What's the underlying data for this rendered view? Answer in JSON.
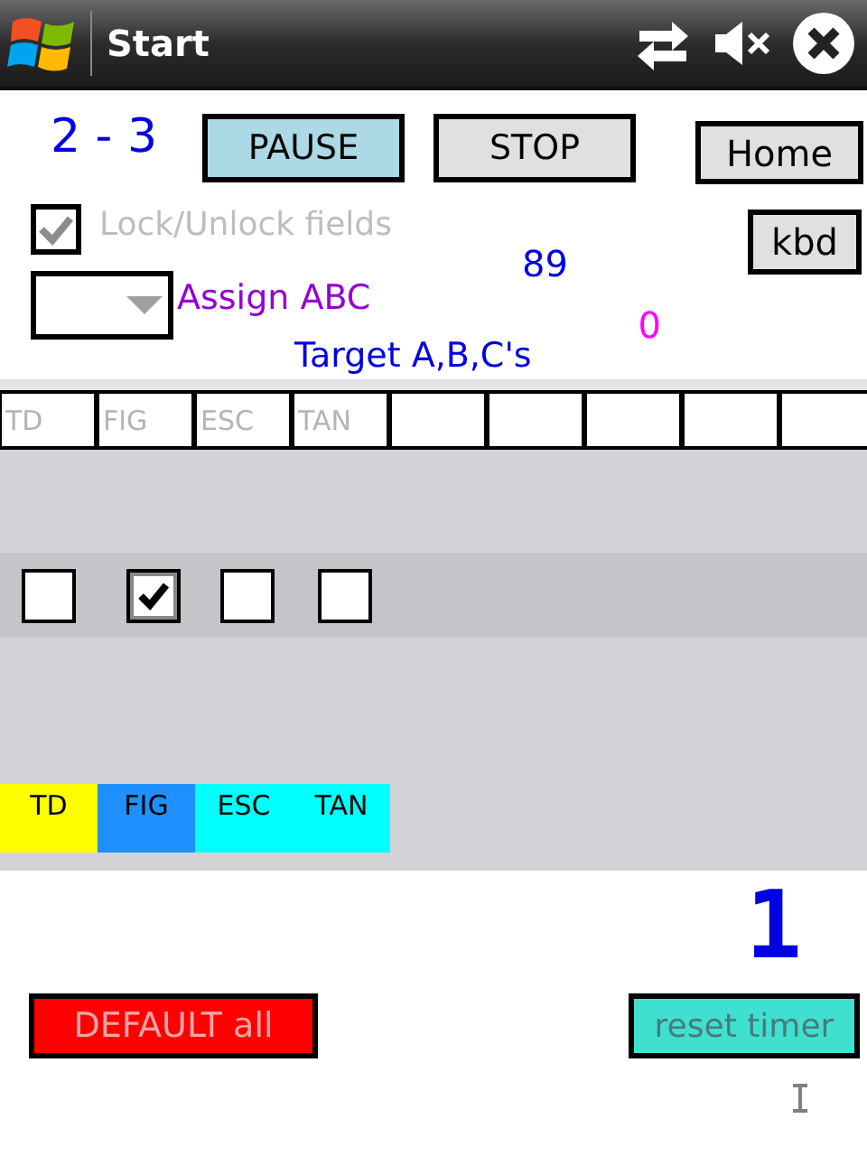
{
  "title_bar": {
    "title": "Start"
  },
  "score": "2 - 3",
  "pause_button": {
    "label": "PAUSE"
  },
  "stop_button": {
    "label": "STOP"
  },
  "home_button": {
    "label": "Home"
  },
  "kbd_button": {
    "label": "kbd"
  },
  "lock_checkbox": {
    "label": "Lock/Unlock fields",
    "checked": true,
    "disabled": true
  },
  "count_a": "89",
  "assign_dropdown": {
    "label": "Assign ABC"
  },
  "count_b": "0",
  "target_label": "Target A,B,C's",
  "fields": [
    {
      "kind": "hint",
      "placeholder": "TD"
    },
    {
      "kind": "hint",
      "placeholder": "FIG"
    },
    {
      "kind": "hint",
      "placeholder": "ESC"
    },
    {
      "kind": "hint",
      "placeholder": "TAN"
    },
    {
      "kind": "blank"
    },
    {
      "kind": "blank"
    },
    {
      "kind": "blank"
    },
    {
      "kind": "blank"
    },
    {
      "kind": "blank"
    }
  ],
  "checkboxes": [
    {
      "checked": false
    },
    {
      "checked": true
    },
    {
      "checked": false
    },
    {
      "checked": false
    }
  ],
  "legend": [
    {
      "label": "TD",
      "color": "#ffff00"
    },
    {
      "label": "FIG",
      "color": "#1e90ff"
    },
    {
      "label": "ESC",
      "color": "#00ffff"
    },
    {
      "label": "TAN",
      "color": "#00ffff"
    }
  ],
  "timer_value": "1",
  "default_button": {
    "label": "DEFAULT all"
  },
  "reset_button": {
    "label": "reset timer"
  }
}
